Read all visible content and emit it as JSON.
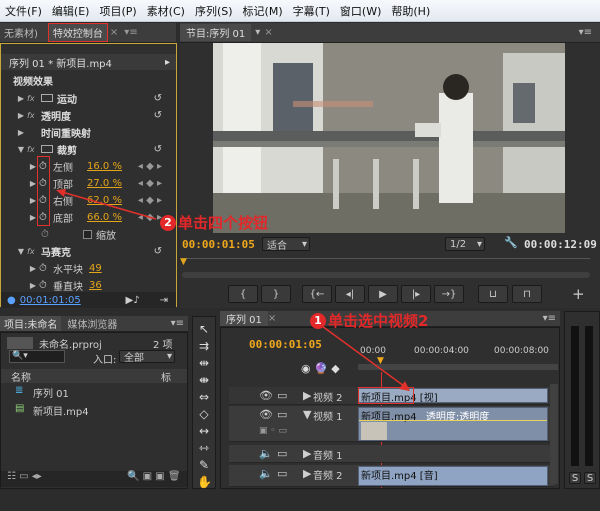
{
  "menu": [
    "文件(F)",
    "编辑(E)",
    "项目(P)",
    "素材(C)",
    "序列(S)",
    "标记(M)",
    "字幕(T)",
    "窗口(W)",
    "帮助(H)"
  ],
  "effect_panel": {
    "left_tab": "无素材)",
    "tab": "特效控制台",
    "clip": "序列 01 * 新项目.mp4",
    "section": "视频效果",
    "fx": [
      {
        "name": "运动"
      },
      {
        "name": "透明度"
      },
      {
        "name": "时间重映射"
      },
      {
        "name": "裁剪"
      }
    ],
    "crop": [
      {
        "name": "左侧",
        "value": "16.0 %"
      },
      {
        "name": "顶部",
        "value": "27.0 %"
      },
      {
        "name": "右侧",
        "value": "62.0 %"
      },
      {
        "name": "底部",
        "value": "66.0 %"
      }
    ],
    "zoom": "缩放",
    "mosaic": "马赛克",
    "horizontal": "水平块",
    "horizontal_val": "49",
    "vertical": "垂直块",
    "vertical_val": "36",
    "time": "00:01:01:05"
  },
  "program": {
    "tab": "节目:序列 01",
    "current": "00:00:01:05",
    "fit": "适合",
    "ratio": "1/2",
    "duration": "00:00:12:09"
  },
  "project": {
    "tab1": "项目:未命名",
    "tab2": "媒体浏览器",
    "file": "未命名.prproj",
    "count": "2 项",
    "entry_label": "入口:",
    "entry": "全部",
    "col_name": "名称",
    "col_tag": "标",
    "items": [
      "序列 01",
      "新项目.mp4"
    ]
  },
  "timeline": {
    "tab": "序列 01",
    "time": "00:00:01:05",
    "ruler": [
      "00:00",
      "00:00:04:00",
      "00:00:08:00"
    ],
    "tracks": [
      "视频 2",
      "视频 1",
      "音频 1",
      "音频 2"
    ],
    "clip_v2": "新项目.mp4 [视]",
    "clip_v1": "新项目.mp4",
    "opacity": "透明度:透明度",
    "clip_a2": "新项目.mp4 [音]"
  },
  "annotations": {
    "one": "1",
    "one_text": "单击选中视频2",
    "two": "2",
    "two_text": "单击四个按钮"
  },
  "audio": {
    "s": "S"
  }
}
